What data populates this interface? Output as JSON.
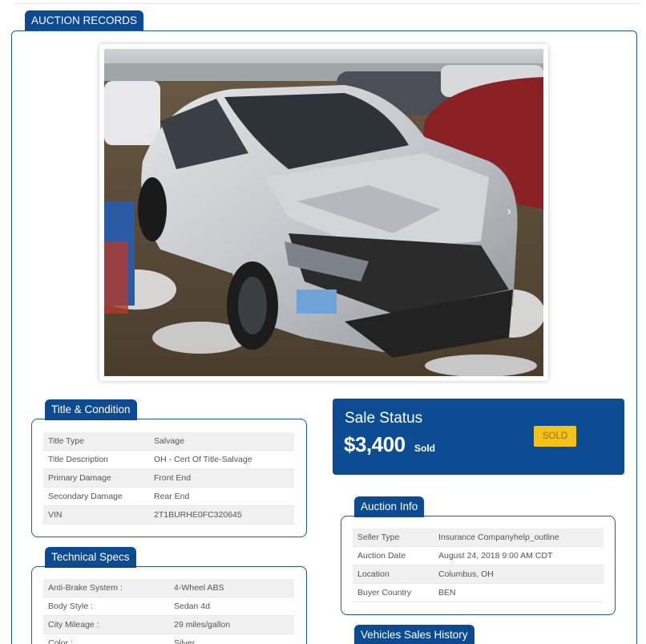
{
  "header": {
    "title": "AUCTION RECORDS"
  },
  "photo": {
    "alt": "Damaged silver Toyota Corolla in salvage yard",
    "next_arrow": "›"
  },
  "title_condition": {
    "title": "Title & Condition",
    "rows": [
      {
        "label": "Title Type",
        "value": "Salvage"
      },
      {
        "label": "Title Description",
        "value": "OH - Cert Of Title-Salvage"
      },
      {
        "label": "Primary Damage",
        "value": "Front End"
      },
      {
        "label": "Secondary Damage",
        "value": "Rear End"
      },
      {
        "label": "VIN",
        "value": "2T1BURHE0FC320645"
      }
    ]
  },
  "sale_status": {
    "title": "Sale Status",
    "price": "$3,400",
    "price_suffix": "Sold",
    "badge": "SOLD",
    "badge_color": "#f5c21b",
    "panel_color": "#0b4c93"
  },
  "auction_info": {
    "title": "Auction Info",
    "rows": [
      {
        "label": "Seller Type",
        "value": "Insurance Companyhelp_outline"
      },
      {
        "label": "Auction Date",
        "value": "August 24, 2018 9:00 AM CDT"
      },
      {
        "label": "Location",
        "value": "Columbus, OH"
      },
      {
        "label": "Buyer Country",
        "value": "BEN"
      }
    ]
  },
  "technical_specs": {
    "title": "Technical Specs",
    "rows": [
      {
        "label": "Anti-Brake System :",
        "value": "4-Wheel ABS"
      },
      {
        "label": "Body Style :",
        "value": "Sedan 4d"
      },
      {
        "label": "City Mileage :",
        "value": "29 miles/gallon"
      },
      {
        "label": "Color :",
        "value": "Silver"
      }
    ]
  },
  "sales_history": {
    "title": "Vehicles Sales History"
  },
  "accent_color": "#0d4a8f"
}
